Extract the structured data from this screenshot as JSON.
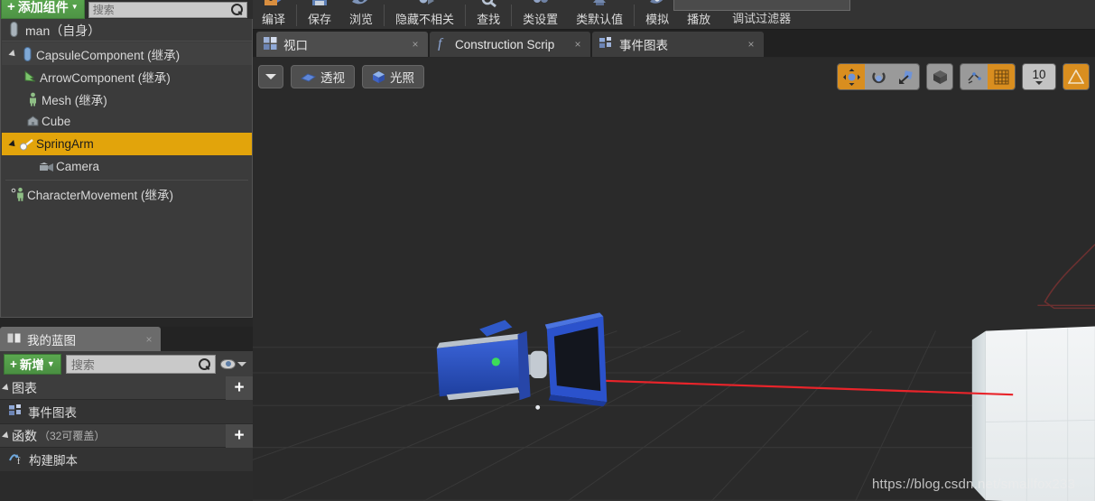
{
  "components_panel": {
    "add_component_button": "添加组件",
    "search_placeholder": "搜索",
    "root": {
      "label": "man（自身）",
      "icon": "capsule-pawn-icon"
    },
    "tree": [
      {
        "label": "CapsuleComponent (继承)",
        "icon": "capsule-icon",
        "depth": 0,
        "expanded": true,
        "selected": false
      },
      {
        "label": "ArrowComponent (继承)",
        "icon": "arrow-icon",
        "depth": 1,
        "expanded": false,
        "selected": false
      },
      {
        "label": "Mesh (继承)",
        "icon": "skeletal-mesh-icon",
        "depth": 1,
        "expanded": false,
        "selected": false
      },
      {
        "label": "Cube",
        "icon": "static-mesh-icon",
        "depth": 1,
        "expanded": false,
        "selected": false
      },
      {
        "label": "SpringArm",
        "icon": "spring-arm-icon",
        "depth": 1,
        "expanded": true,
        "selected": true
      },
      {
        "label": "Camera",
        "icon": "camera-icon",
        "depth": 2,
        "expanded": false,
        "selected": false
      },
      {
        "label": "CharacterMovement (继承)",
        "icon": "character-movement-icon",
        "depth": 0,
        "expanded": false,
        "selected": false
      }
    ]
  },
  "my_blueprint_panel": {
    "tab_label": "我的蓝图",
    "tab_icon": "book-icon",
    "add_button": "新增",
    "search_placeholder": "搜索",
    "eye_icon": "visibility-eye-icon",
    "sections": [
      {
        "title": "图表",
        "note": "",
        "add_label": "+",
        "items": [
          {
            "label": "事件图表",
            "icon": "event-graph-icon"
          }
        ]
      },
      {
        "title": "函数",
        "note": "（32可覆盖）",
        "add_label": "+",
        "items": [
          {
            "label": "构建脚本",
            "icon": "construction-script-icon"
          }
        ]
      }
    ]
  },
  "main_toolbar": {
    "buttons": [
      {
        "label": "编译",
        "icon": "compile-icon"
      },
      {
        "label": "保存",
        "icon": "save-icon"
      },
      {
        "label": "浏览",
        "icon": "browse-icon"
      },
      {
        "label": "隐藏不相关",
        "icon": "hide-unrelated-icon"
      },
      {
        "label": "查找",
        "icon": "find-icon"
      },
      {
        "label": "类设置",
        "icon": "class-settings-icon"
      },
      {
        "label": "类默认值",
        "icon": "class-defaults-icon"
      },
      {
        "label": "模拟",
        "icon": "simulate-icon"
      },
      {
        "label": "播放",
        "icon": "play-icon"
      }
    ],
    "debug_filter_label": "调试过滤器",
    "debug_filter_value": ""
  },
  "document_tabs": [
    {
      "label": "视口",
      "icon": "viewport-icon",
      "active": true,
      "closable": true
    },
    {
      "label": "Construction Scrip",
      "icon": "function-f-icon",
      "active": false,
      "closable": true
    },
    {
      "label": "事件图表",
      "icon": "event-graph-icon",
      "active": false,
      "closable": true
    }
  ],
  "viewport": {
    "dropdown_icon": "chevron-down-icon",
    "view_mode": "透视",
    "lighting_mode": "光照",
    "tools": [
      {
        "name": "translate-gizmo",
        "active": true
      },
      {
        "name": "rotate-gizmo",
        "active": false
      },
      {
        "name": "scale-gizmo",
        "active": false
      },
      {
        "name": "world-space-toggle",
        "active": false
      },
      {
        "name": "surface-snap",
        "active": false
      },
      {
        "name": "grid-snap",
        "active": true
      }
    ],
    "grid_snap_value": "10",
    "warning_icon": "warning-triangle-icon",
    "watermark": "https://blog.csdn.net/smallfox233",
    "scene_objects": [
      {
        "name": "camera-mesh",
        "color": "#2b4fb8"
      },
      {
        "name": "cube-mesh",
        "color": "#eceff1"
      },
      {
        "name": "spring-arm-debug-line",
        "color": "#e8242a"
      },
      {
        "name": "capsule-collision-outline",
        "color": "#5c2a2a"
      }
    ]
  },
  "colors": {
    "selection": "#e2a40b",
    "accent_green": "#5aa84f",
    "panel_bg": "#3b3b3b",
    "viewport_bg": "#2a2a2a",
    "toolbar_bg": "#333333"
  }
}
